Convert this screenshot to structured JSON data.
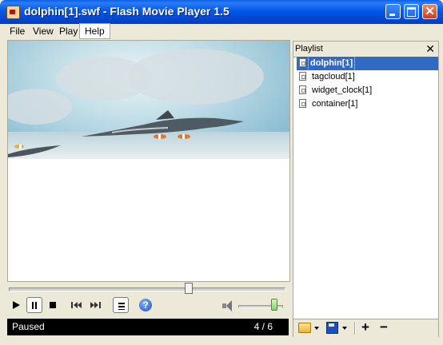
{
  "window": {
    "title": "dolphin[1].swf - Flash Movie Player 1.5",
    "controls": {
      "minimize": "minimize-icon",
      "maximize": "maximize-icon",
      "close": "close-icon"
    }
  },
  "menu": [
    "File",
    "View",
    "Play",
    "Help"
  ],
  "player": {
    "seek_position": 0.66,
    "volume_level": 0.9,
    "help_label": "?",
    "status": "Paused",
    "position": "4 / 6"
  },
  "playlist": {
    "title": "Playlist",
    "close_label": "✕",
    "items": [
      "dolphin[1]",
      "tagcloud[1]",
      "widget_clock[1]",
      "container[1]"
    ],
    "selected_index": 0,
    "toolbar": {
      "plus": "+",
      "minus": "−"
    }
  },
  "colors": {
    "titlebar": "#0058e8",
    "selection": "#316ac5",
    "status_bg": "#000000"
  }
}
